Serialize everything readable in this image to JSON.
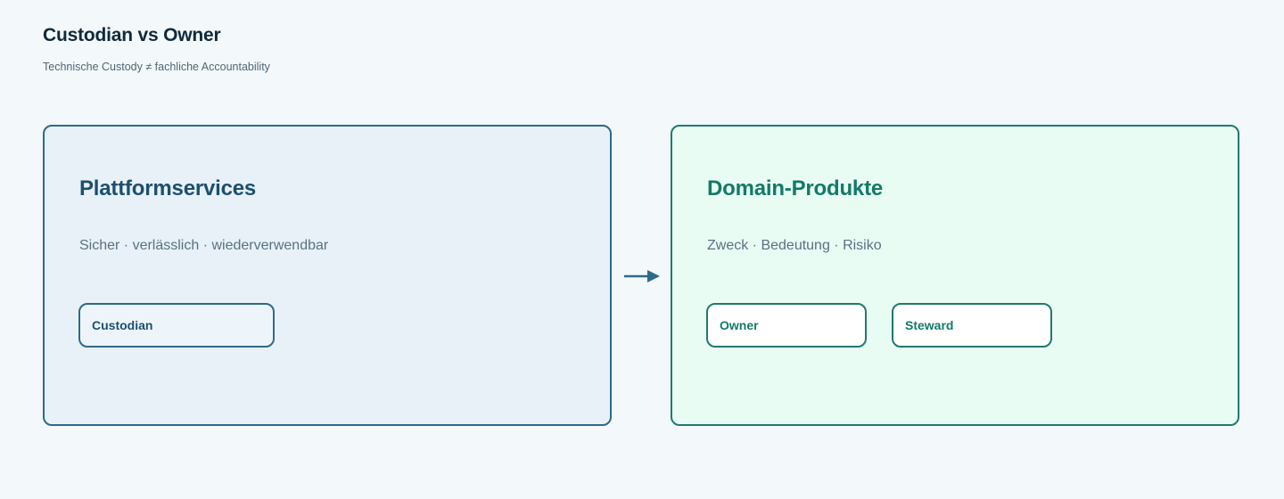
{
  "header": {
    "title": "Custodian vs Owner",
    "subtitle": "Technische Custody ≠ fachliche Accountability"
  },
  "left_panel": {
    "title": "Plattformservices",
    "description": "Sicher · verlässlich · wiederverwendbar",
    "roles": [
      "Custodian"
    ]
  },
  "right_panel": {
    "title": "Domain-Produkte",
    "description": "Zweck · Bedeutung · Risiko",
    "roles": [
      "Owner",
      "Steward"
    ]
  },
  "connector": {
    "icon": "arrow-right-icon"
  },
  "colors": {
    "background": "#f3f8fb",
    "left_accent": "#2d6a8a",
    "left_fill": "#e8f1f8",
    "right_accent": "#1f7a6e",
    "right_fill": "#e9fcf4"
  }
}
